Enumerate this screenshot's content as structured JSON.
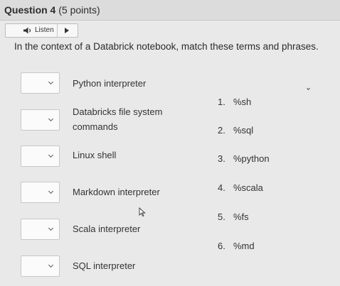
{
  "question": {
    "title": "Question 4",
    "points": "(5 points)"
  },
  "listen": {
    "label": "Listen"
  },
  "prompt": "In the context of a Databrick notebook, match these terms and phrases.",
  "terms": [
    {
      "label": "Python interpreter"
    },
    {
      "label": "Databricks file system commands",
      "line1": "Databricks file system",
      "line2": "commands"
    },
    {
      "label": "Linux shell"
    },
    {
      "label": "Markdown interpreter"
    },
    {
      "label": "Scala interpreter"
    },
    {
      "label": "SQL interpreter"
    }
  ],
  "answers": [
    {
      "number": "1.",
      "value": "%sh"
    },
    {
      "number": "2.",
      "value": "%sql"
    },
    {
      "number": "3.",
      "value": "%python"
    },
    {
      "number": "4.",
      "value": "%scala"
    },
    {
      "number": "5.",
      "value": "%fs"
    },
    {
      "number": "6.",
      "value": "%md"
    }
  ],
  "icons": {
    "speaker": "speaker-icon",
    "play": "play-icon",
    "dropdown": "chevron-down-icon"
  }
}
